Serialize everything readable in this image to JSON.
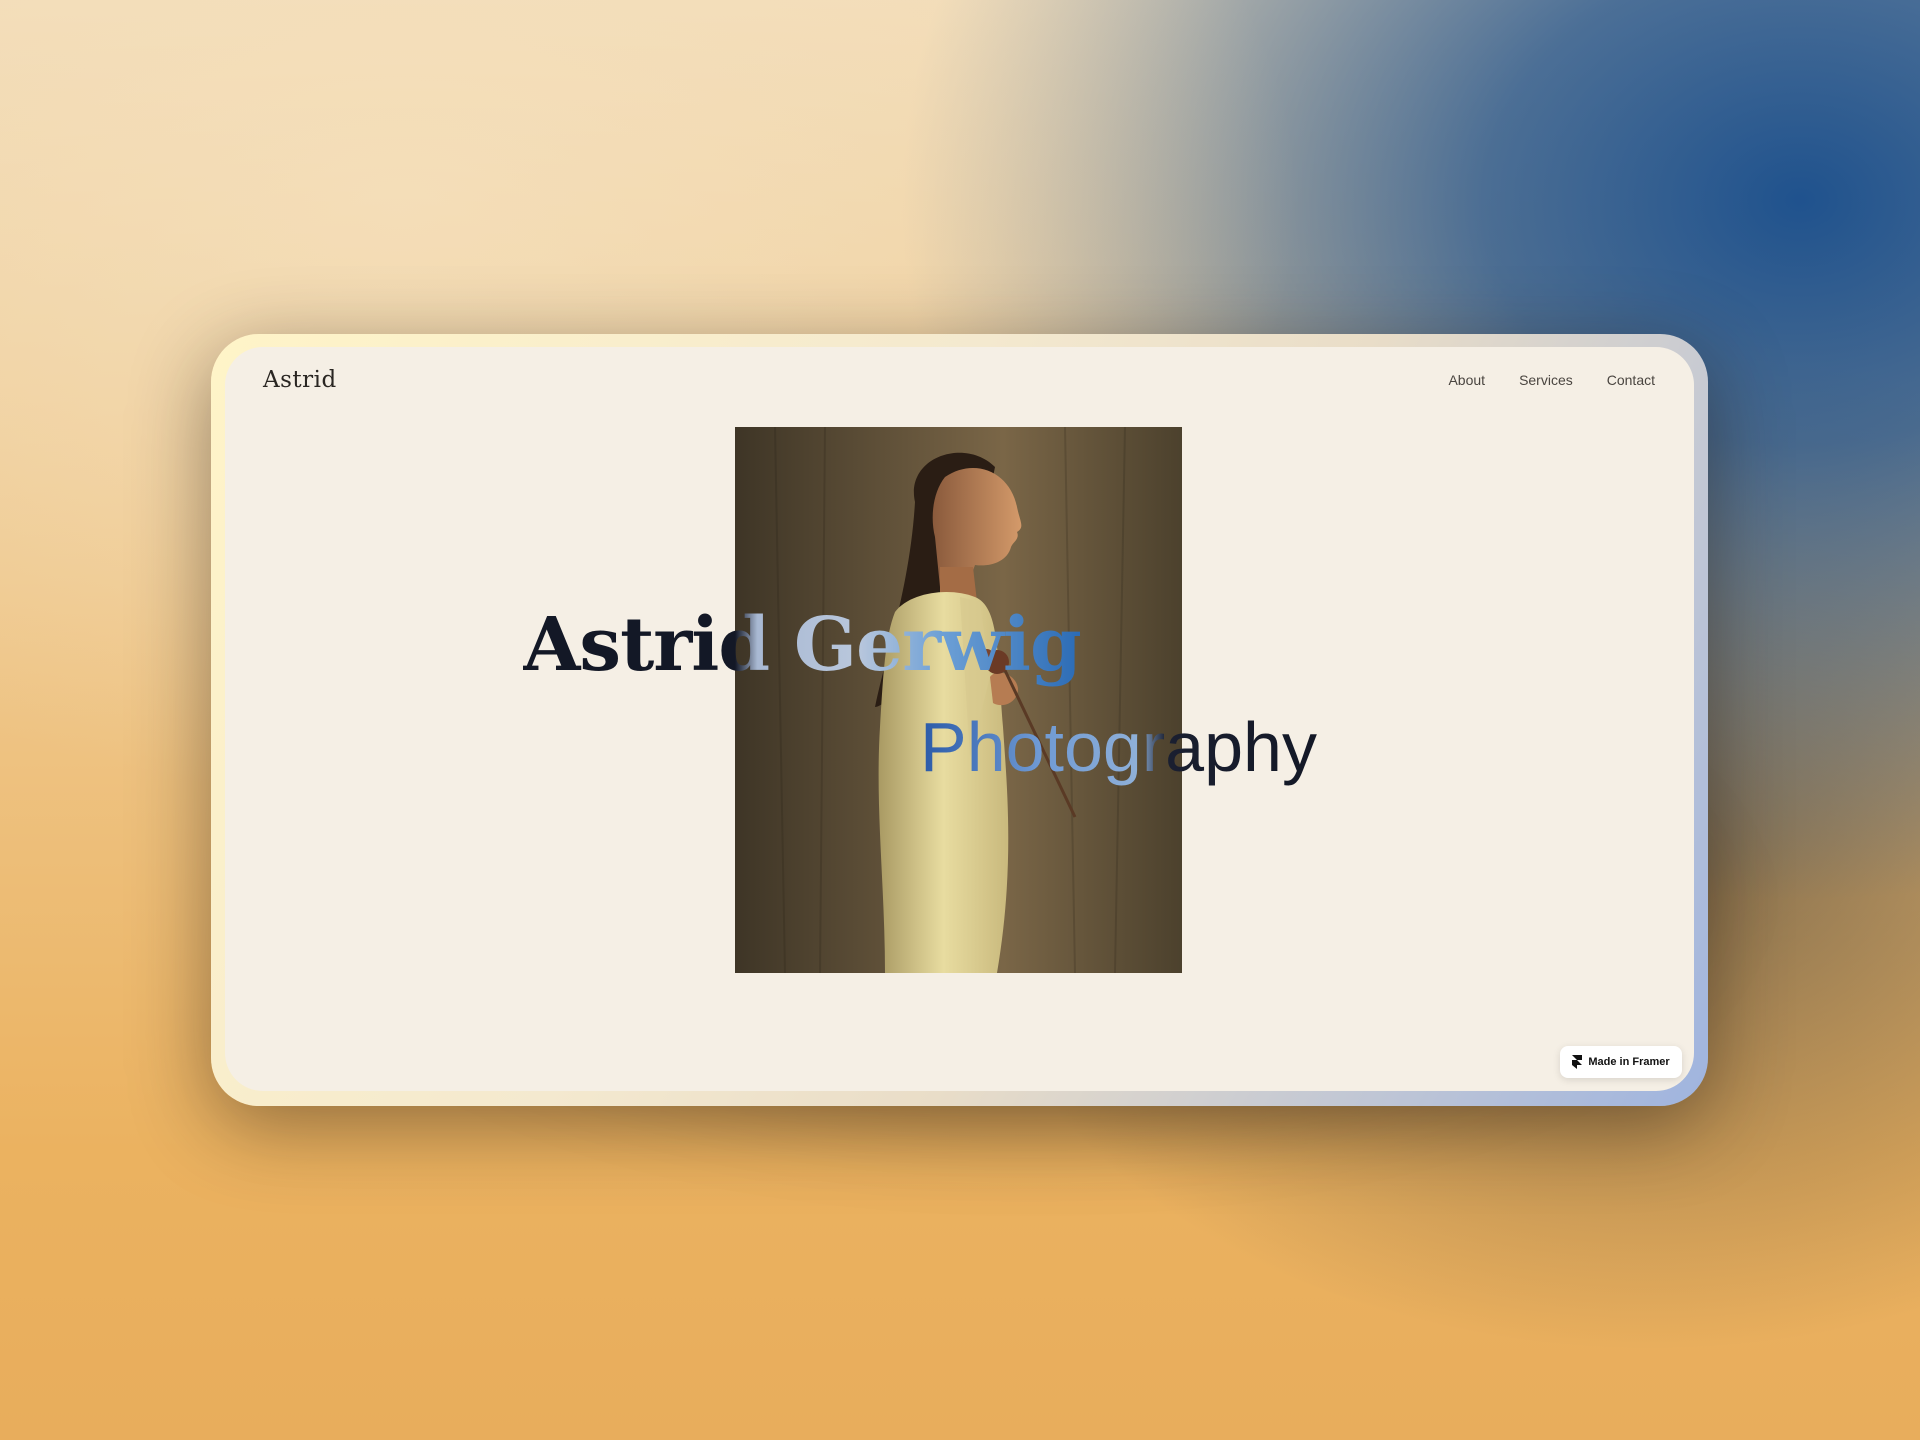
{
  "site": {
    "logo": "Astrid"
  },
  "nav": {
    "items": [
      {
        "label": "About"
      },
      {
        "label": "Services"
      },
      {
        "label": "Contact"
      }
    ]
  },
  "hero": {
    "headline": "Astrid Gerwig",
    "subline": "Photography",
    "photo_alt_icon": "portrait-photo"
  },
  "badge": {
    "label": "Made in Framer",
    "icon": "framer-logo-icon"
  },
  "colors": {
    "page_bg": "#f5efe5",
    "text_dark": "#131826",
    "accent_blue": "#2b6bb5",
    "accent_light_blue": "#a9b9d3"
  }
}
